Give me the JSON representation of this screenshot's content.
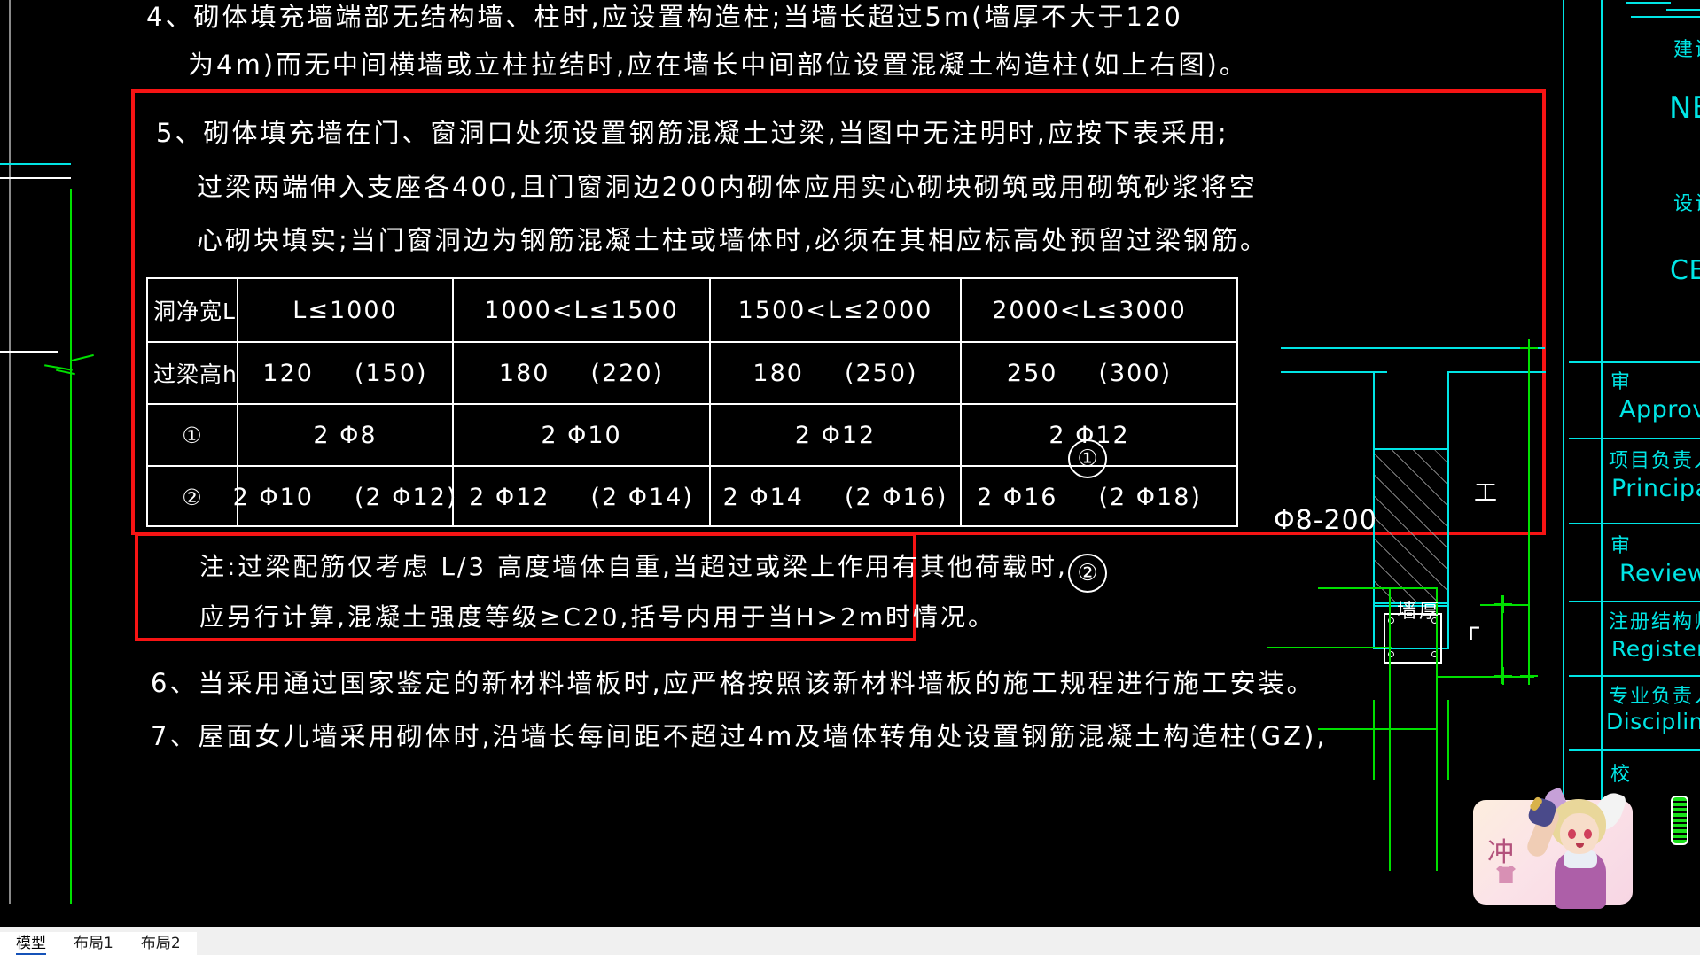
{
  "app": {
    "background": "#000000",
    "accent_red": "#f71414",
    "cad_white": "#ffffff",
    "cad_cyan": "#00e5e5",
    "cad_green": "#00e000"
  },
  "drawing_notes": {
    "item4": {
      "line1": "4、砌体填充墙端部无结构墙、柱时,应设置构造柱;当墙长超过5m(墙厚不大于120",
      "line2": "为4m)而无中间横墙或立柱拉结时,应在墙长中间部位设置混凝土构造柱(如上右图)。"
    },
    "item5": {
      "line1": "5、砌体填充墙在门、窗洞口处须设置钢筋混凝土过梁,当图中无注明时,应按下表采用;",
      "line2": "过梁两端伸入支座各400,且门窗洞边200内砌体应用实心砌块砌筑或用砌筑砂浆将空",
      "line3": "心砌块填实;当门窗洞边为钢筋混凝土柱或墙体时,必须在其相应标高处预留过梁钢筋。"
    },
    "table_note": {
      "line1": "注:过梁配筋仅考虑 L/3 高度墙体自重,当超过或梁上作用有其他荷载时,",
      "line2": "应另行计算,混凝土强度等级≥C20,括号内用于当H>2m时情况。"
    },
    "item6": "6、当采用通过国家鉴定的新材料墙板时,应严格按照该新材料墙板的施工规程进行施工安装。",
    "item7": "7、屋面女儿墙采用砌体时,沿墙长每间距不超过4m及墙体转角处设置钢筋混凝土构造柱(GZ),"
  },
  "lintel_table": {
    "columns_header_label": "洞净宽L",
    "rows": [
      {
        "label": "洞净宽L",
        "cells": [
          {
            "main": "L≤1000",
            "paren": ""
          },
          {
            "main": "1000<L≤1500",
            "paren": ""
          },
          {
            "main": "1500<L≤2000",
            "paren": ""
          },
          {
            "main": "2000<L≤3000",
            "paren": ""
          }
        ]
      },
      {
        "label": "过梁高h",
        "cells": [
          {
            "main": "120",
            "paren": "(150)"
          },
          {
            "main": "180",
            "paren": "(220)"
          },
          {
            "main": "180",
            "paren": "(250)"
          },
          {
            "main": "250",
            "paren": "(300)"
          }
        ]
      },
      {
        "label": "①",
        "cells": [
          {
            "main": "2 Φ8",
            "paren": ""
          },
          {
            "main": "2 Φ10",
            "paren": ""
          },
          {
            "main": "2 Φ12",
            "paren": ""
          },
          {
            "main": "2 Φ12",
            "paren": ""
          }
        ]
      },
      {
        "label": "②",
        "cells": [
          {
            "main": "2 Φ10",
            "paren": "(2 Φ12)"
          },
          {
            "main": "2 Φ12",
            "paren": "(2 Φ14)"
          },
          {
            "main": "2 Φ14",
            "paren": "(2 Φ16)"
          },
          {
            "main": "2 Φ16",
            "paren": "(2 Φ18)"
          }
        ]
      }
    ]
  },
  "detail_drawing": {
    "stirrup_label": "Φ8-200",
    "wall_thickness_label": "墙厚",
    "bubble_1": "①",
    "bubble_2": "②",
    "dim_tick_upper": "工",
    "dim_tick_lower": "ᴦ"
  },
  "title_block": {
    "rows": [
      {
        "cn": "建设单位",
        "en": ""
      },
      {
        "cn": "",
        "en": "NE"
      },
      {
        "cn": "设计",
        "en": ""
      },
      {
        "cn": "",
        "en": "CE"
      },
      {
        "cn": "审",
        "en": "Approv"
      },
      {
        "cn": "项目负责人",
        "en": "Principal"
      },
      {
        "cn": "审",
        "en": "Review"
      },
      {
        "cn": "注册结构师",
        "en": "Registered st"
      },
      {
        "cn": "专业负责人",
        "en": "Discipline"
      },
      {
        "cn": "校",
        "en": ""
      }
    ]
  },
  "tabs": {
    "items": [
      {
        "label": "模型",
        "active": true
      },
      {
        "label": "布局1",
        "active": false
      },
      {
        "label": "布局2",
        "active": false
      }
    ]
  },
  "overlay_widget": {
    "stamp_char": "冲",
    "name": "character-card"
  }
}
